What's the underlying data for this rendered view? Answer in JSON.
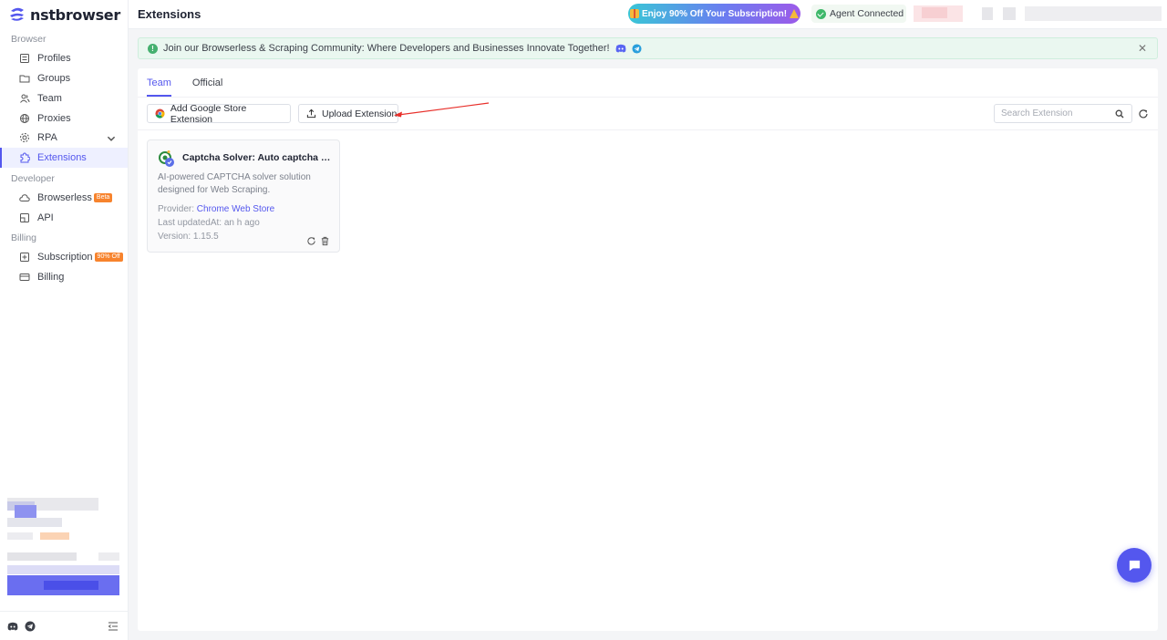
{
  "app": {
    "name": "nstbrowser"
  },
  "header": {
    "title": "Extensions",
    "promo": "Enjoy 90% Off Your Subscription!",
    "agent_status": "Agent Connected"
  },
  "sidebar": {
    "sections": {
      "browser": "Browser",
      "developer": "Developer",
      "billing": "Billing"
    },
    "items": [
      {
        "label": "Profiles",
        "icon": "profile-icon"
      },
      {
        "label": "Groups",
        "icon": "folder-icon"
      },
      {
        "label": "Team",
        "icon": "team-icon"
      },
      {
        "label": "Proxies",
        "icon": "globe-icon"
      },
      {
        "label": "RPA",
        "icon": "rpa-icon"
      },
      {
        "label": "Extensions",
        "icon": "puzzle-icon",
        "active": true
      },
      {
        "label": "Browserless",
        "icon": "cloud-icon",
        "tag": "Beta"
      },
      {
        "label": "API",
        "icon": "api-icon"
      },
      {
        "label": "Subscription",
        "icon": "subscription-icon",
        "tag": "90% Off"
      },
      {
        "label": "Billing",
        "icon": "card-icon"
      }
    ]
  },
  "banner": {
    "text": "Join our Browserless & Scraping Community: Where Developers and Businesses Innovate Together!"
  },
  "tabs": [
    {
      "label": "Team",
      "active": true
    },
    {
      "label": "Official",
      "active": false
    }
  ],
  "toolbar": {
    "add_google": "Add Google Store Extension",
    "upload": "Upload Extension",
    "search_placeholder": "Search Extension"
  },
  "extensions": [
    {
      "title": "Captcha Solver: Auto captcha solving service",
      "description": "AI-powered CAPTCHA solver solution designed for Web Scraping.",
      "provider_label": "Provider:",
      "provider": "Chrome Web Store",
      "updated": "Last updatedAt: an h ago",
      "version": "Version: 1.15.5"
    }
  ],
  "colors": {
    "accent": "#5457ee",
    "success": "#3eb86a",
    "tag": "#f7832d"
  }
}
